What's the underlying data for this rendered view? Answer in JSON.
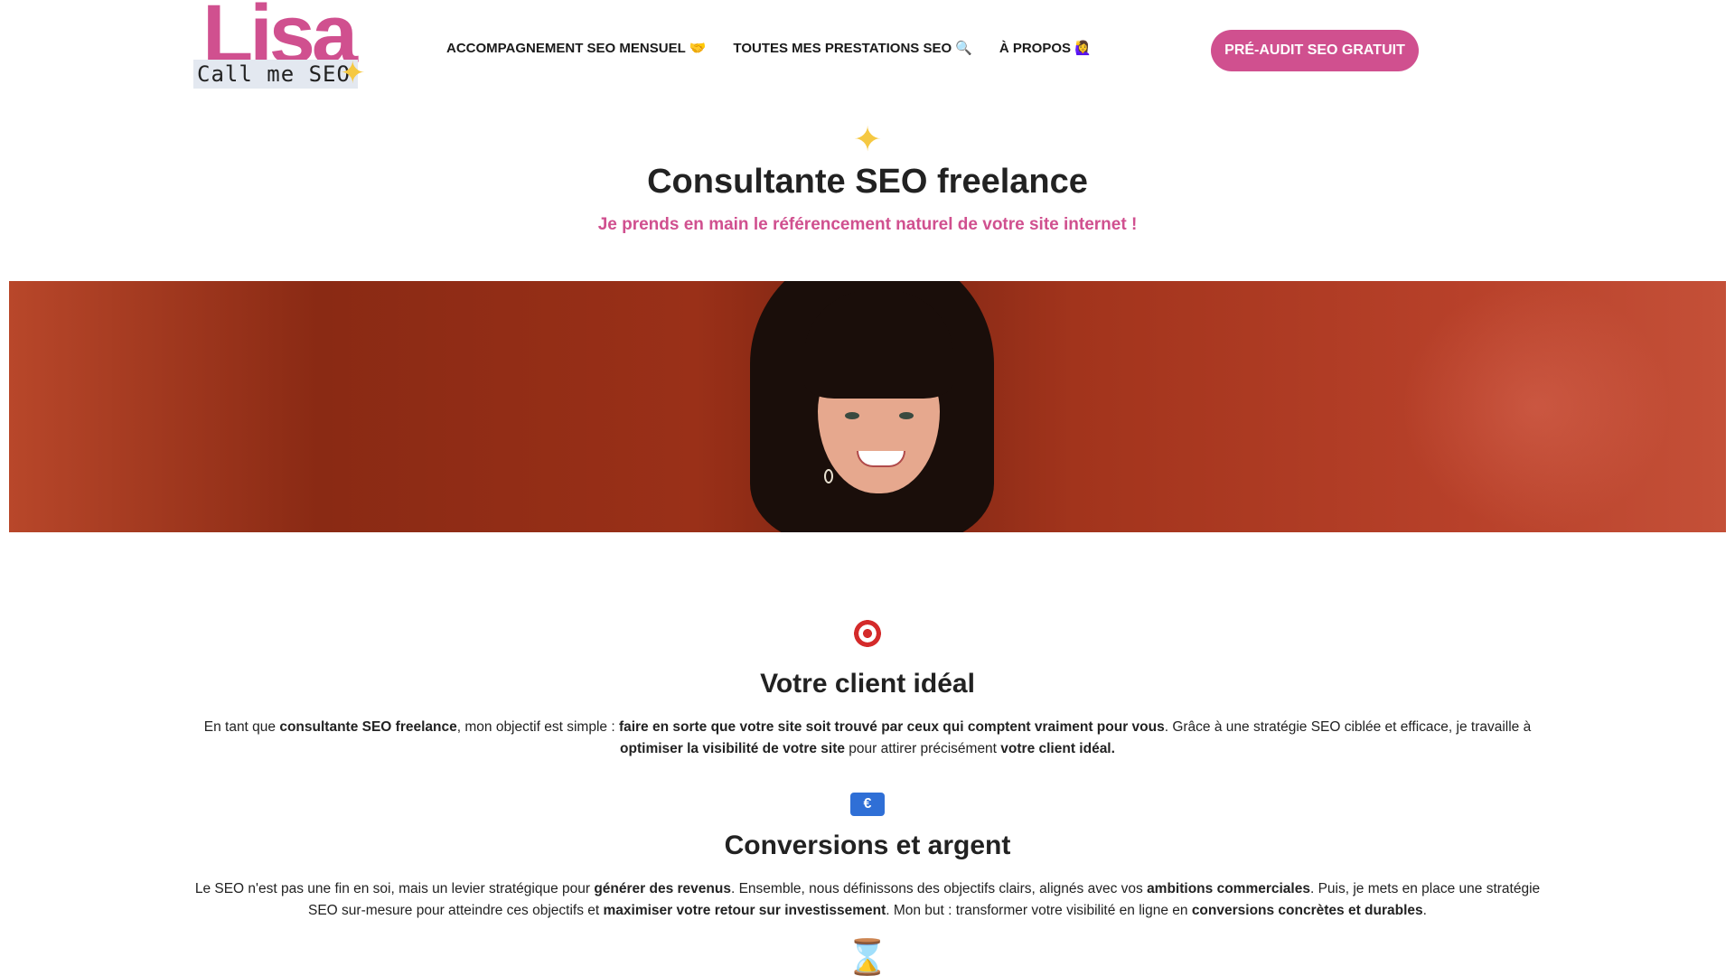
{
  "logo": {
    "name": "Lisa",
    "tagline": "Call me SEO",
    "spark": "✦"
  },
  "nav": {
    "items": [
      {
        "label": "ACCOMPAGNEMENT SEO MENSUEL",
        "emoji": "🤝"
      },
      {
        "label": "TOUTES MES PRESTATIONS SEO",
        "emoji": "🔍"
      },
      {
        "label": "À PROPOS",
        "emoji": "🙋‍♀️"
      }
    ],
    "cta": "PRÉ-AUDIT SEO GRATUIT"
  },
  "hero": {
    "spark": "✦",
    "title": "Consultante SEO freelance",
    "subtitle": "Je prends en main le référencement naturel de votre site internet !"
  },
  "sections": [
    {
      "icon": "target-icon",
      "title": "Votre client idéal",
      "parts": [
        [
          "En tant que ",
          false
        ],
        [
          "consultante SEO freelance",
          true
        ],
        [
          ", mon objectif est simple : ",
          false
        ],
        [
          "faire en sorte que votre site soit trouvé par ceux qui comptent vraiment pour vous",
          true
        ],
        [
          ". Grâce à une stratégie SEO ciblée et efficace, je travaille à ",
          false
        ],
        [
          "optimiser la visibilité de votre site",
          true
        ],
        [
          " pour attirer précisément ",
          false
        ],
        [
          "votre client idéal.",
          true
        ]
      ]
    },
    {
      "icon": "euro-banknote-icon",
      "euro_glyph": "€",
      "title": "Conversions et argent",
      "parts": [
        [
          "Le SEO n'est pas une fin en soi, mais un levier stratégique pour ",
          false
        ],
        [
          "générer des revenus",
          true
        ],
        [
          ". Ensemble, nous définissons des objectifs clairs, alignés avec vos ",
          false
        ],
        [
          "ambitions commerciales",
          true
        ],
        [
          ". Puis, je mets en place une stratégie SEO sur-mesure pour atteindre ces objectifs et ",
          false
        ],
        [
          "maximiser votre retour sur investissement",
          true
        ],
        [
          ". Mon but : transformer votre visibilité en ligne en ",
          false
        ],
        [
          "conversions concrètes et durables",
          true
        ],
        [
          ".",
          false
        ]
      ]
    },
    {
      "icon": "hourglass-icon",
      "glyph": "⌛"
    }
  ],
  "colors": {
    "brand_pink": "#d0508f",
    "spark_yellow": "#f5c842",
    "banner_red": "#a2341c"
  }
}
